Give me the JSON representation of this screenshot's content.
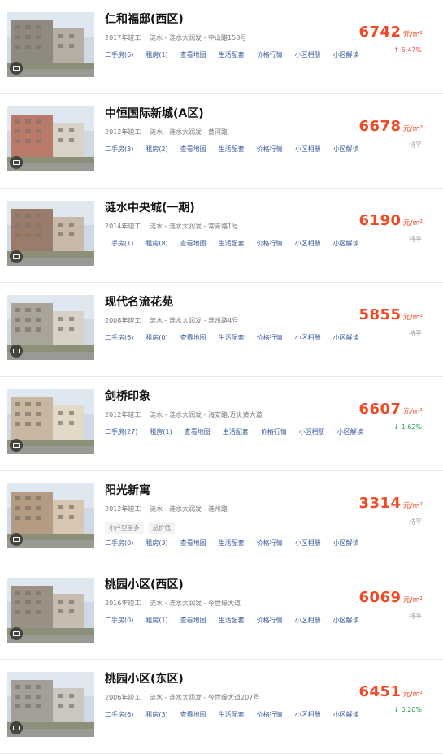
{
  "listings": [
    {
      "name": "仁和福邸(西区)",
      "year": "2017年竣工",
      "district": "涟水",
      "area": "涟水大润发",
      "address": "中山路158号",
      "links": [
        "二手房(6)",
        "租房(1)",
        "查看地图",
        "生活配套",
        "价格行情",
        "小区相册",
        "小区解读"
      ],
      "tags": [],
      "price": "6742",
      "unit": "元/m²",
      "change": "↑ 5.47%",
      "change_type": "up"
    },
    {
      "name": "中恒国际新城(A区)",
      "year": "2012年竣工",
      "district": "涟水",
      "area": "涟水大润发",
      "address": "黄河路",
      "links": [
        "二手房(3)",
        "租房(2)",
        "查看地图",
        "生活配套",
        "价格行情",
        "小区相册",
        "小区解读"
      ],
      "tags": [],
      "price": "6678",
      "unit": "元/m²",
      "change": "持平",
      "change_type": "flat"
    },
    {
      "name": "涟水中央城(一期)",
      "year": "2014年竣工",
      "district": "涟水",
      "area": "涟水大润发",
      "address": "常青路1号",
      "links": [
        "二手房(1)",
        "租房(8)",
        "查看地图",
        "生活配套",
        "价格行情",
        "小区相册",
        "小区解读"
      ],
      "tags": [],
      "price": "6190",
      "unit": "元/m²",
      "change": "持平",
      "change_type": "flat"
    },
    {
      "name": "现代名流花苑",
      "year": "2008年竣工",
      "district": "涟水",
      "area": "涟水大润发",
      "address": "涟州路4号",
      "links": [
        "二手房(6)",
        "租房(0)",
        "查看地图",
        "生活配套",
        "价格行情",
        "小区相册",
        "小区解读"
      ],
      "tags": [],
      "price": "5855",
      "unit": "元/m²",
      "change": "持平",
      "change_type": "flat"
    },
    {
      "name": "剑桥印象",
      "year": "2012年竣工",
      "district": "涟水",
      "area": "涟水大润发",
      "address": "海安路,近炎黄大道",
      "links": [
        "二手房(27)",
        "租房(1)",
        "查看地图",
        "生活配套",
        "价格行情",
        "小区相册",
        "小区解读"
      ],
      "tags": [],
      "price": "6607",
      "unit": "元/m²",
      "change": "↓ 1.62%",
      "change_type": "down"
    },
    {
      "name": "阳光新寓",
      "year": "2012年竣工",
      "district": "涟水",
      "area": "涟水大润发",
      "address": "涟州路",
      "links": [
        "二手房(0)",
        "租房(3)",
        "查看地图",
        "生活配套",
        "价格行情",
        "小区相册",
        "小区解读"
      ],
      "tags": [
        "小户型居多",
        "总价低"
      ],
      "price": "3314",
      "unit": "元/m²",
      "change": "持平",
      "change_type": "flat"
    },
    {
      "name": "桃园小区(西区)",
      "year": "2016年竣工",
      "district": "涟水",
      "area": "涟水大润发",
      "address": "今世缘大道",
      "links": [
        "二手房(0)",
        "租房(1)",
        "查看地图",
        "生活配套",
        "价格行情",
        "小区相册",
        "小区解读"
      ],
      "tags": [],
      "price": "6069",
      "unit": "元/m²",
      "change": "持平",
      "change_type": "flat"
    },
    {
      "name": "桃园小区(东区)",
      "year": "2006年竣工",
      "district": "涟水",
      "area": "涟水大润发",
      "address": "今世缘大道207号",
      "links": [
        "二手房(6)",
        "租房(3)",
        "查看地图",
        "生活配套",
        "价格行情",
        "小区相册",
        "小区解读"
      ],
      "tags": [],
      "price": "6451",
      "unit": "元/m²",
      "change": "↓ 0.20%",
      "change_type": "down"
    }
  ]
}
